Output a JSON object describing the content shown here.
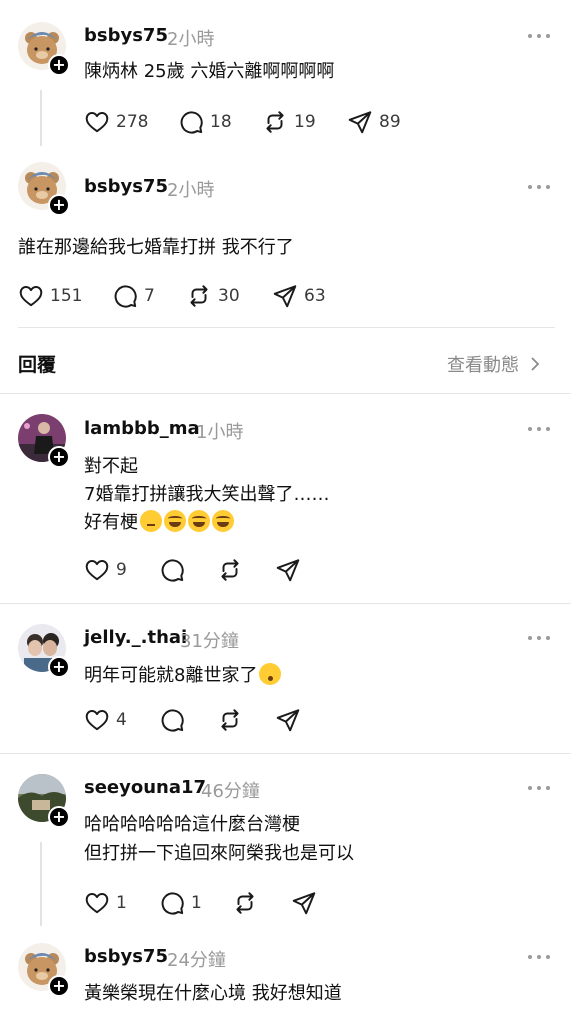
{
  "posts": [
    {
      "username": "bsbys75",
      "time": "2小時",
      "text": "陳炳林 25歲 六婚六離啊啊啊啊",
      "likes": "278",
      "comments": "18",
      "reposts": "19",
      "shares": "89"
    },
    {
      "username": "bsbys75",
      "time": "2小時",
      "text": "誰在那邊給我七婚靠打拼 我不行了",
      "likes": "151",
      "comments": "7",
      "reposts": "30",
      "shares": "63"
    }
  ],
  "replies_section": {
    "title": "回覆",
    "view_activity": "查看動態"
  },
  "replies": [
    {
      "username": "lambbb_ma",
      "time": "1小時",
      "lines": [
        "對不起",
        "7婚靠打拼讓我大笑出聲了……",
        "好有梗"
      ],
      "emojis": [
        "thinking-face",
        "laughing-tears",
        "laughing-tears",
        "laughing-tears"
      ],
      "likes": "9"
    },
    {
      "username": "jelly._.thai",
      "time": "31分鐘",
      "lines": [
        "明年可能就8離世家了"
      ],
      "emojis": [
        "kissing-face"
      ],
      "likes": "4"
    },
    {
      "username": "seeyouna17",
      "time": "46分鐘",
      "lines": [
        "哈哈哈哈哈哈這什麼台灣梗",
        "但打拼一下追回來阿榮我也是可以"
      ],
      "likes": "1",
      "comments": "1"
    },
    {
      "username": "bsbys75",
      "time": "24分鐘",
      "lines": [
        "黃樂榮現在什麼心境 我好想知道"
      ]
    }
  ],
  "icons": [
    "heart-icon",
    "comment-icon",
    "repost-icon",
    "send-icon",
    "more-icon",
    "chevron-right-icon",
    "follow-plus-icon"
  ],
  "colors": {
    "text": "#101010",
    "muted": "#9a9a9a",
    "divider": "#e6e6e6"
  }
}
